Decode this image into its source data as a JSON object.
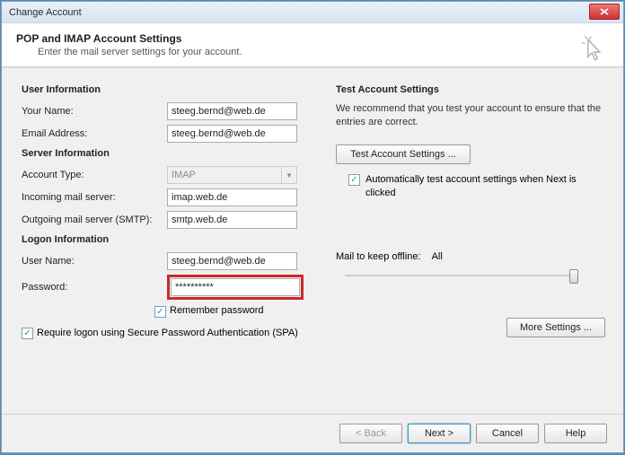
{
  "window": {
    "title": "Change Account"
  },
  "header": {
    "title": "POP and IMAP Account Settings",
    "subtitle": "Enter the mail server settings for your account."
  },
  "left": {
    "user_info_title": "User Information",
    "your_name_label": "Your Name:",
    "your_name_value": "steeg.bernd@web.de",
    "email_label": "Email Address:",
    "email_value": "steeg.bernd@web.de",
    "server_info_title": "Server Information",
    "account_type_label": "Account Type:",
    "account_type_value": "IMAP",
    "incoming_label": "Incoming mail server:",
    "incoming_value": "imap.web.de",
    "outgoing_label": "Outgoing mail server (SMTP):",
    "outgoing_value": "smtp.web.de",
    "logon_info_title": "Logon Information",
    "username_label": "User Name:",
    "username_value": "steeg.bernd@web.de",
    "password_label": "Password:",
    "password_value": "**********",
    "remember_label": "Remember password",
    "spa_label": "Require logon using Secure Password Authentication (SPA)"
  },
  "right": {
    "test_title": "Test Account Settings",
    "test_desc": "We recommend that you test your account to ensure that the entries are correct.",
    "test_button": "Test Account Settings ...",
    "auto_test_label": "Automatically test account settings when Next is clicked",
    "mail_keep_label": "Mail to keep offline:",
    "mail_keep_value": "All",
    "more_settings": "More Settings ..."
  },
  "footer": {
    "back": "< Back",
    "next": "Next >",
    "cancel": "Cancel",
    "help": "Help"
  }
}
